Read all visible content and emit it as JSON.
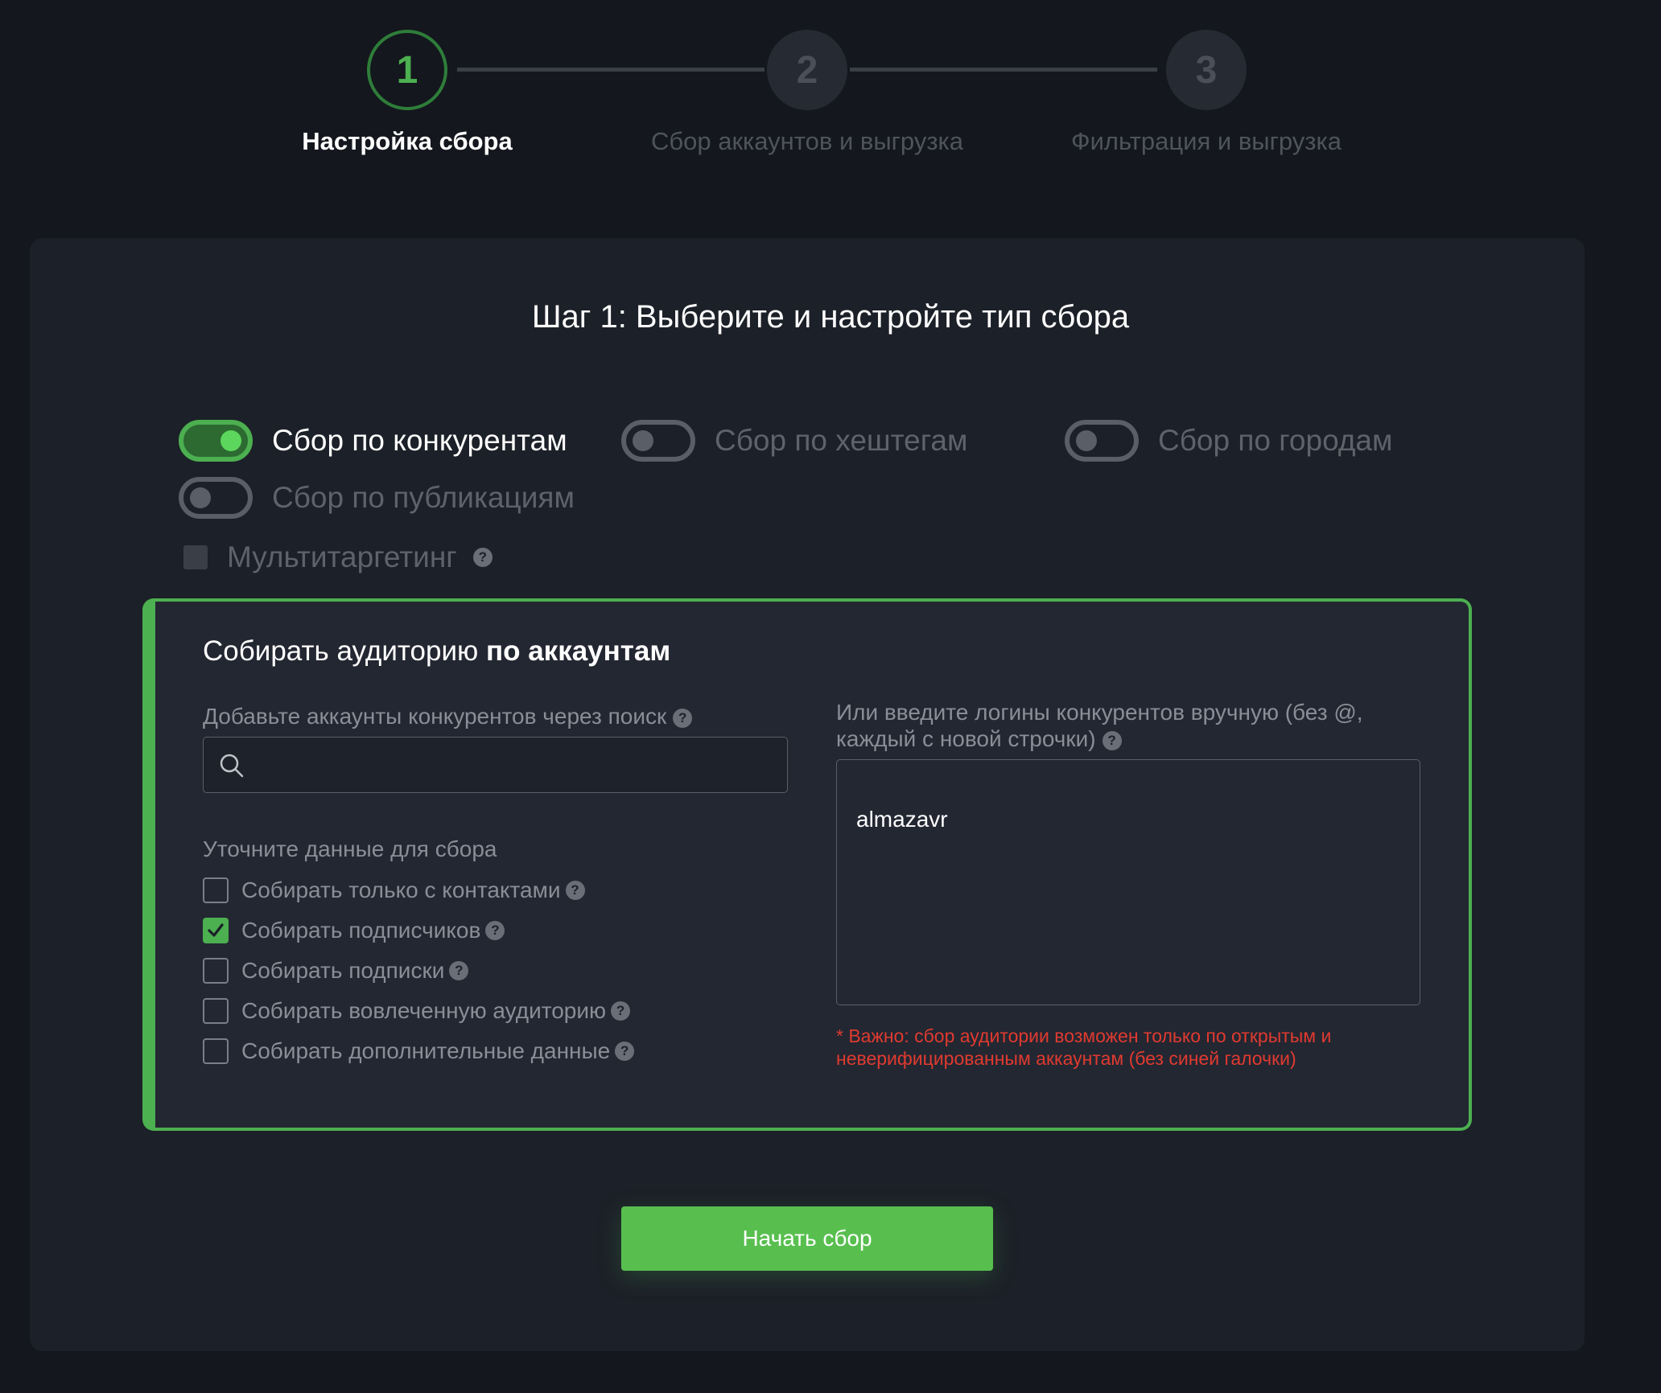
{
  "stepper": {
    "steps": [
      {
        "number": "1",
        "label": "Настройка сбора",
        "state": "active"
      },
      {
        "number": "2",
        "label": "Сбор аккаунтов и выгрузка",
        "state": "inactive"
      },
      {
        "number": "3",
        "label": "Фильтрация и выгрузка",
        "state": "inactive"
      }
    ]
  },
  "card": {
    "title": "Шаг 1: Выберите и настройте тип сбора"
  },
  "collection_types": [
    {
      "label": "Сбор по конкурентам",
      "on": true
    },
    {
      "label": "Сбор по хештегам",
      "on": false
    },
    {
      "label": "Сбор по городам",
      "on": false
    },
    {
      "label": "Сбор по публикациям",
      "on": false
    }
  ],
  "multitargeting": {
    "label": "Мультитаргетинг",
    "checked": false,
    "help": "?"
  },
  "panel": {
    "title_prefix": "Собирать аудиторию ",
    "title_bold": "по аккаунтам",
    "search": {
      "label": "Добавьте аккаунты конкурентов через поиск",
      "placeholder": "",
      "value": ""
    },
    "details_label": "Уточните данные для сбора",
    "options": [
      {
        "label": "Собирать только с контактами",
        "checked": false
      },
      {
        "label": "Собирать подписчиков",
        "checked": true
      },
      {
        "label": "Собирать подписки",
        "checked": false
      },
      {
        "label": "Собирать вовлеченную аудиторию",
        "checked": false
      },
      {
        "label": "Собирать дополнительные данные",
        "checked": false
      }
    ],
    "manual": {
      "label_line1": "Или введите логины конкурентов вручную (без @,",
      "label_line2": "каждый с новой строчки)",
      "value": "almazavr"
    },
    "warning_line1": "* Важно: сбор аудитории возможен только по открытым и",
    "warning_line2": "неверифицированным аккаунтам (без синей галочки)"
  },
  "help_glyph": "?",
  "start_button": "Начать сбор",
  "colors": {
    "background": "#14171d",
    "card": "#1c2028",
    "panel": "#232732",
    "accent": "#4caf50",
    "button": "#58bf4f",
    "warning": "#e03a2f"
  }
}
